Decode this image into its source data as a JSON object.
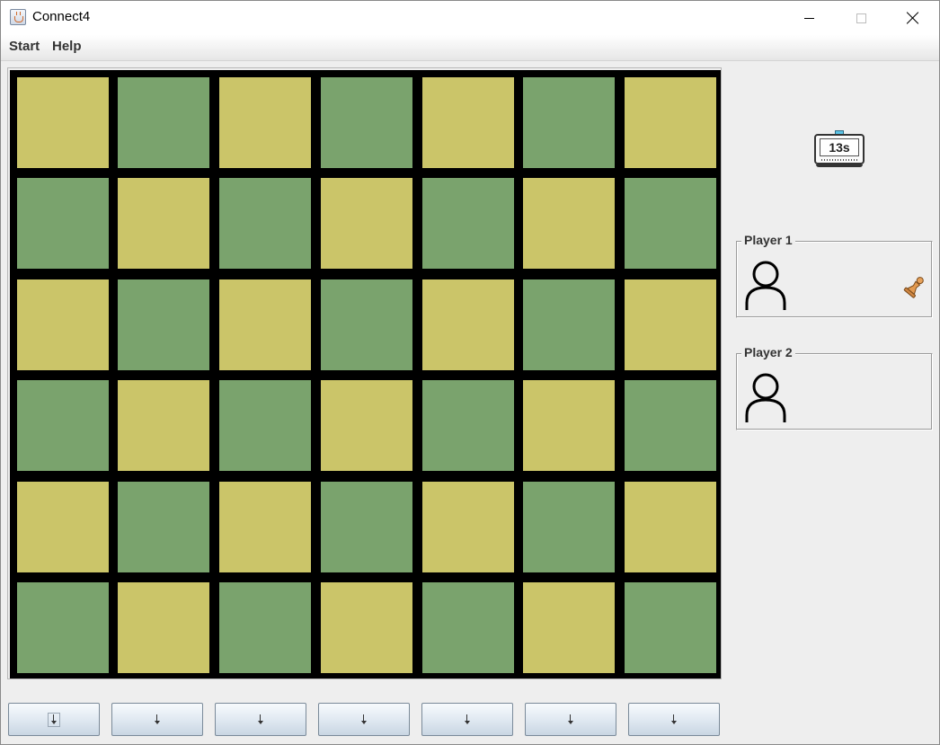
{
  "window": {
    "title": "Connect4",
    "controls": {
      "minimize": "minimize",
      "maximize": "maximize",
      "close": "close"
    }
  },
  "menu": {
    "items": [
      "Start",
      "Help"
    ]
  },
  "board": {
    "rows": 6,
    "cols": 7,
    "colors": {
      "yellow": "#cbc569",
      "green": "#7aa36d",
      "grid": "#000000"
    },
    "pattern": [
      [
        "yellow",
        "green",
        "yellow",
        "green",
        "yellow",
        "green",
        "yellow"
      ],
      [
        "green",
        "yellow",
        "green",
        "yellow",
        "green",
        "yellow",
        "green"
      ],
      [
        "yellow",
        "green",
        "yellow",
        "green",
        "yellow",
        "green",
        "yellow"
      ],
      [
        "green",
        "yellow",
        "green",
        "yellow",
        "green",
        "yellow",
        "green"
      ],
      [
        "yellow",
        "green",
        "yellow",
        "green",
        "yellow",
        "green",
        "yellow"
      ],
      [
        "green",
        "yellow",
        "green",
        "yellow",
        "green",
        "yellow",
        "green"
      ]
    ]
  },
  "drop_buttons": {
    "count": 7,
    "icon": "down-arrow-icon",
    "focused_index": 0
  },
  "timer": {
    "value": "13s",
    "icon": "timer-icon"
  },
  "players": [
    {
      "label": "Player 1",
      "avatar_icon": "person-icon",
      "active": true,
      "turn_icon": "chess-pawn-icon"
    },
    {
      "label": "Player 2",
      "avatar_icon": "person-icon",
      "active": false
    }
  ]
}
